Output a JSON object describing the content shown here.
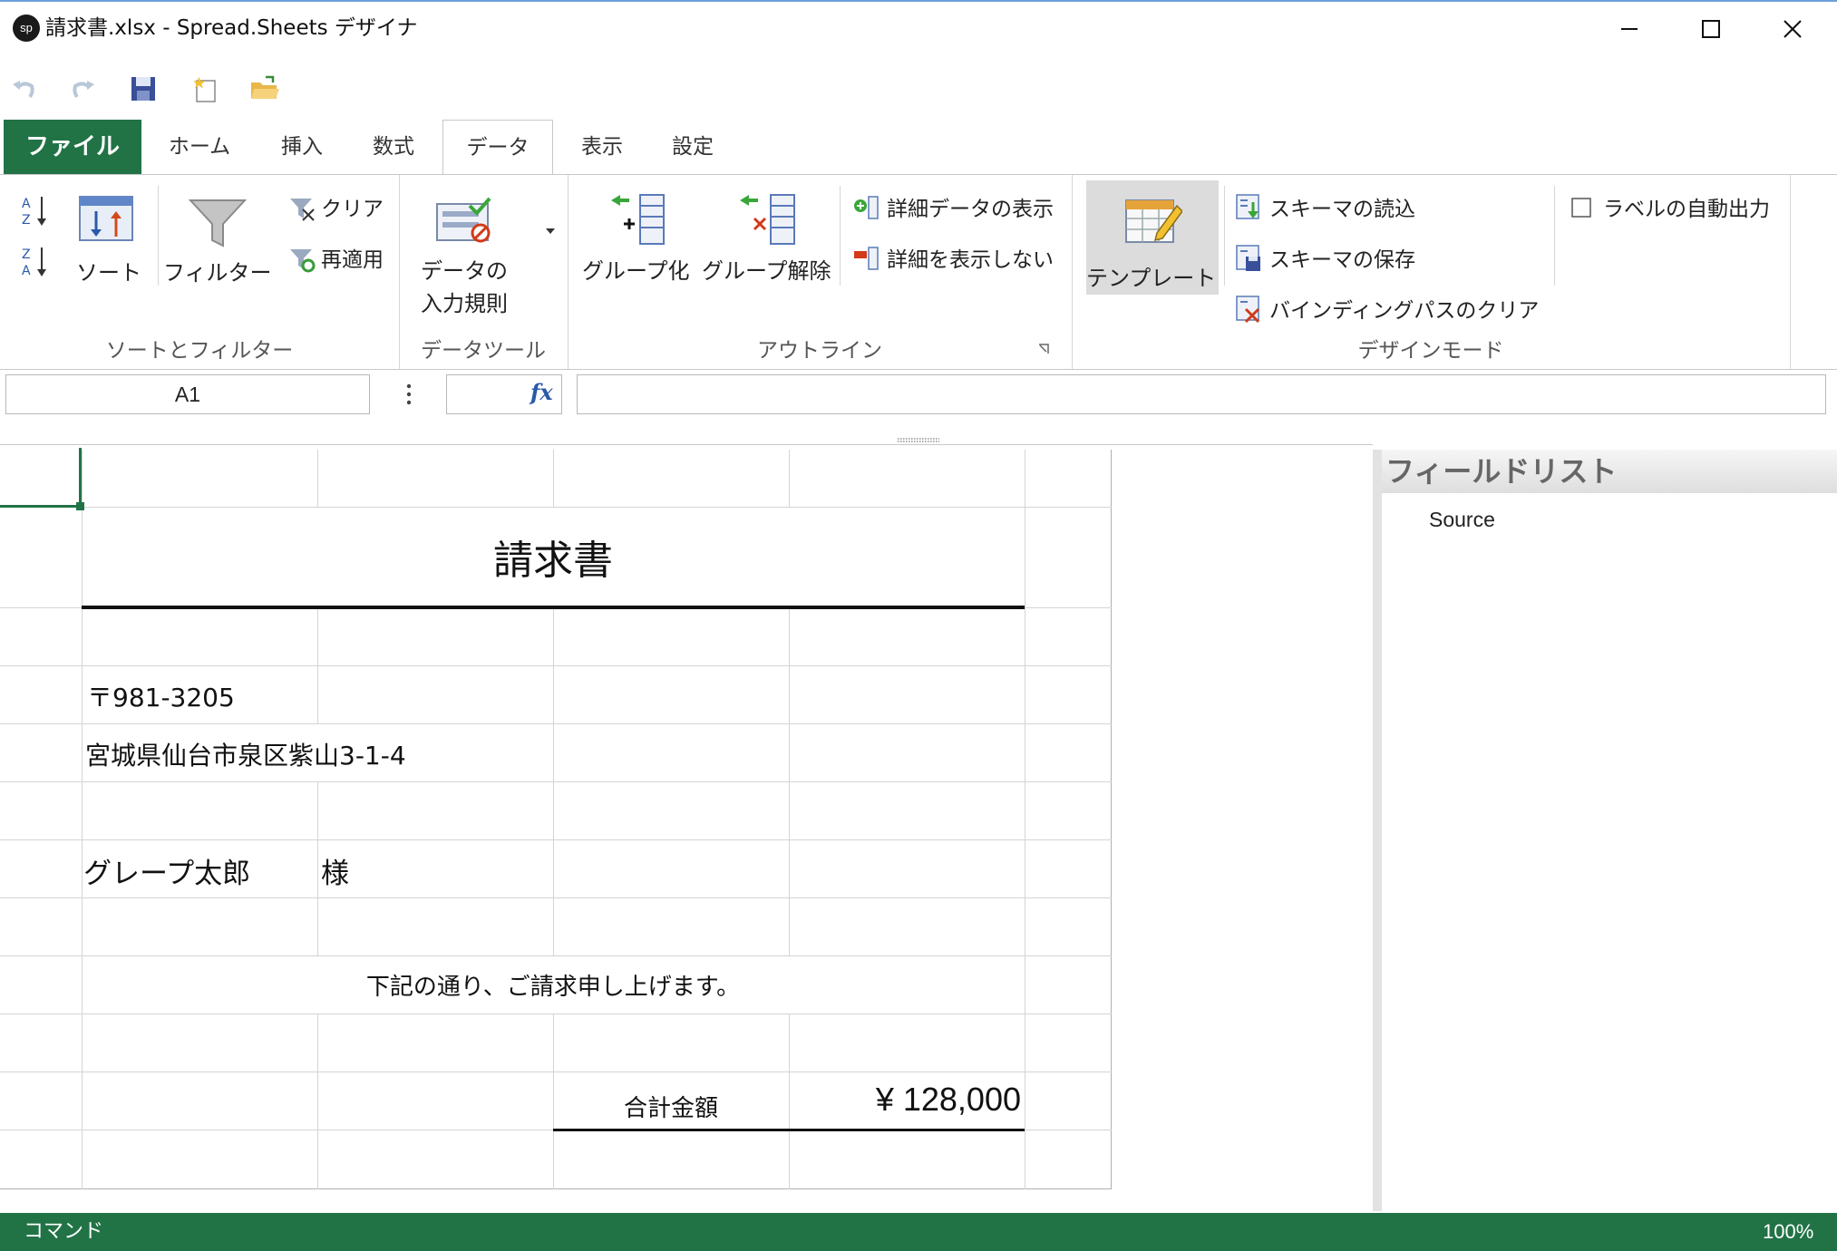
{
  "window": {
    "title": "請求書.xlsx - Spread.Sheets デザイナ",
    "app_icon_text": "sp",
    "minimize": "─",
    "maximize": "☐",
    "close": "✕"
  },
  "quick_access": [
    "undo-icon",
    "redo-icon",
    "save-icon",
    "new-icon",
    "open-icon"
  ],
  "tabs": {
    "file": "ファイル",
    "home": "ホーム",
    "insert": "挿入",
    "formula": "数式",
    "data": "データ",
    "view": "表示",
    "settings": "設定"
  },
  "ribbon": {
    "sort_filter": {
      "sort": "ソート",
      "filter": "フィルター",
      "clear": "クリア",
      "reapply": "再適用",
      "group_label": "ソートとフィルター"
    },
    "data_tools": {
      "validation_line1": "データの",
      "validation_line2": "入力規則",
      "group_label": "データツール"
    },
    "outline": {
      "group": "グループ化",
      "ungroup": "グループ解除",
      "show_detail": "詳細データの表示",
      "hide_detail": "詳細を表示しない",
      "group_label": "アウトライン"
    },
    "design_mode": {
      "template": "テンプレート",
      "load_schema": "スキーマの読込",
      "save_schema": "スキーマの保存",
      "clear_binding": "バインディングパスのクリア",
      "auto_label": "ラベルの自動出力",
      "group_label": "デザインモード"
    }
  },
  "formula_bar": {
    "name_box": "A1",
    "fx": "fx",
    "formula": ""
  },
  "sheet": {
    "title": "請求書",
    "postal": "〒981-3205",
    "address": "宮城県仙台市泉区紫山3-1-4",
    "customer": "グレープ太郎",
    "honorific": "様",
    "message": "下記の通り、ご請求申し上げます。",
    "total_label": "合計金額",
    "total_value": "¥ 128,000"
  },
  "field_list": {
    "header": "フィールドリスト",
    "items": [
      "Source"
    ]
  },
  "status": {
    "mode": "コマンド",
    "zoom": "100%"
  },
  "colors": {
    "accent": "#217346",
    "title_border": "#6aa0d8"
  }
}
